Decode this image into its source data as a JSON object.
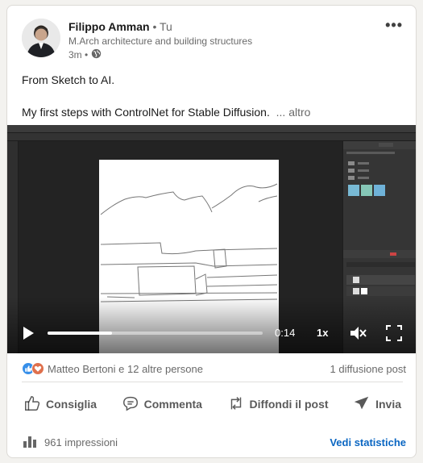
{
  "post": {
    "author": {
      "name": "Filippo Amman",
      "degree": "• Tu",
      "headline": "M.Arch architecture and building structures",
      "time": "3m •",
      "visibility_icon": "globe-icon"
    },
    "more_icon": "•••",
    "text_line1": "From Sketch to AI.",
    "text_line2": "My first steps with ControlNet for Stable Diffusion.",
    "see_more": "... altro"
  },
  "video": {
    "time": "0:14",
    "rate": "1x",
    "progress": 0.3,
    "muted": true,
    "controls": [
      "play-icon",
      "mute-icon",
      "fullscreen-icon"
    ]
  },
  "social": {
    "reactions": "Matteo Bertoni e 12 altre persone",
    "reaction_icons": [
      "like-icon",
      "love-icon"
    ],
    "reposts": "1 diffusione post"
  },
  "actions": {
    "like": "Consiglia",
    "comment": "Commenta",
    "repost": "Diffondi il post",
    "send": "Invia"
  },
  "analytics": {
    "impressions": "961 impressioni",
    "stats": "Vedi statistiche"
  },
  "colors": {
    "link": "#0a66c2",
    "like": "#378fe9",
    "love": "#df704d"
  }
}
